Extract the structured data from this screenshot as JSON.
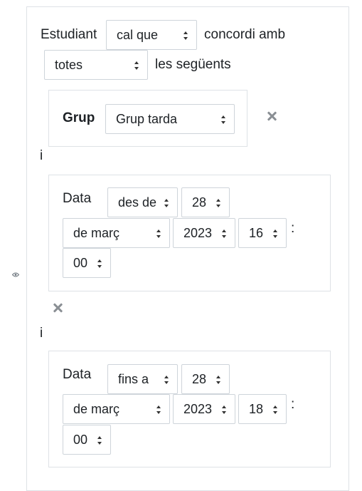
{
  "eye_icon": "eye-icon",
  "condition": {
    "label_student": "Estudiant",
    "must_select": "cal que",
    "label_match": "concordi amb",
    "scope_select": "totes",
    "label_following": "les següents"
  },
  "group_restriction": {
    "label": "Grup",
    "value": "Grup tarda"
  },
  "joiner_1": "i",
  "date_restriction_1": {
    "label": "Data",
    "direction": "des de",
    "day": "28",
    "month": "de març",
    "year": "2023",
    "hour": "16",
    "colon": ":",
    "minute": "00"
  },
  "joiner_2": "i",
  "date_restriction_2": {
    "label": "Data",
    "direction": "fins a",
    "day": "28",
    "month": "de març",
    "year": "2023",
    "hour": "18",
    "colon": ":",
    "minute": "00"
  },
  "colors": {
    "border": "#dee2e6",
    "select_border": "#ced4da",
    "delete_icon": "#8a8f94",
    "text": "#1d2125"
  }
}
